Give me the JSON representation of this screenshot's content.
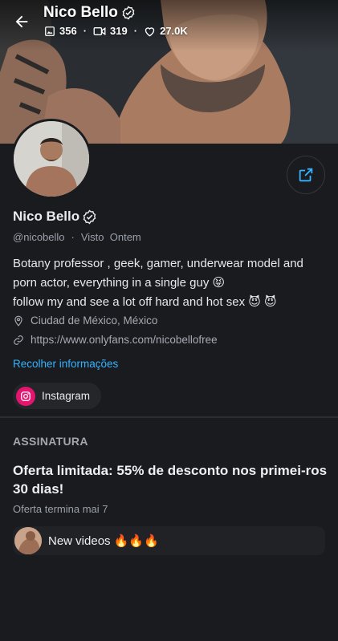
{
  "header": {
    "name": "Nico Bello",
    "stats": [
      {
        "icon": "image-icon",
        "value": "356"
      },
      {
        "icon": "video-icon",
        "value": "319"
      },
      {
        "icon": "heart-icon",
        "value": "27.0K"
      }
    ]
  },
  "profile": {
    "name": "Nico Bello",
    "handle": "@nicobello",
    "separator": "·",
    "seen_label": "Visto  Ontem",
    "bio_line1": "Botany professor , geek, gamer, underwear model and porn actor, everything in a single guy 😝",
    "bio_line2": "follow my and see a lot off hard and hot sex 😈 😈",
    "location": "Ciudad de México, México",
    "website": "https://www.onlyfans.com/nicobellofree",
    "collapse_label": "Recolher informações",
    "social": {
      "label": "Instagram",
      "icon": "instagram-icon",
      "color": "#e4156f"
    }
  },
  "subscription": {
    "section_label": "ASSINATURA",
    "offer_title": "Oferta limitada: 55% de desconto nos primei-ros 30 dias!",
    "offer_ends": "Oferta termina mai 7"
  },
  "post_preview": {
    "text": "New videos 🔥🔥🔥"
  },
  "colors": {
    "background": "#1a1b1e",
    "accent": "#34b3ff",
    "muted": "#9aa0a8"
  }
}
